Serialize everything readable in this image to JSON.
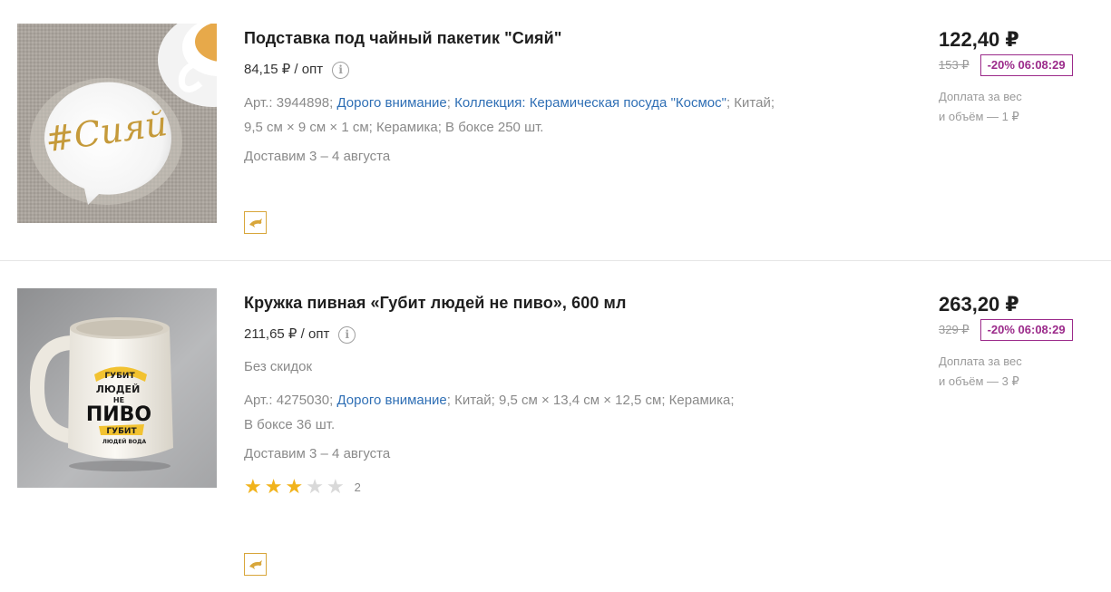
{
  "products": [
    {
      "title": "Подставка под чайный пакетик \"Сияй\"",
      "wholesale_price": "84,15 ₽ / опт",
      "info_icon": "info-circle-icon",
      "details_line1": {
        "sku": "Арт.: 3944898;",
        "tag": "Дорого внимание",
        "sep1": ";",
        "collection": "Коллекция: Керамическая посуда \"Космос\"",
        "sep2": ";",
        "country": "Китай;"
      },
      "details_line2": "9,5 см × 9 см × 1 см;  Керамика;  В боксе 250 шт.",
      "image_text": "#Сияй",
      "delivery": "Доставим 3 – 4 августа",
      "badge_icon": "dolphin-icon",
      "price": "122,40 ₽",
      "old_price": "153 ₽",
      "discount": "-20% 06:08:29",
      "extra_line1": "Доплата за вес",
      "extra_line2": "и объём — 1 ₽"
    },
    {
      "title": "Кружка пивная «Губит людей не пиво», 600 мл",
      "wholesale_price": "211,65 ₽ / опт",
      "info_icon": "info-circle-icon",
      "no_discount": "Без скидок",
      "details_line1": {
        "sku": "Арт.: 4275030;",
        "tag": "Дорого внимание",
        "rest": ";  Китай;  9,5 см × 13,4 см × 12,5 см;  Керамика;"
      },
      "details_line2": "В боксе 36 шт.",
      "image_text": {
        "top": "ГУБИТ",
        "line1": "ЛЮДЕЙ",
        "line2": "НЕ",
        "line3": "ПИВО",
        "line4": "ГУБИТ",
        "line5": "ЛЮДЕЙ ВОДА"
      },
      "delivery": "Доставим 3 – 4 августа",
      "rating": 3,
      "rating_max": 5,
      "rating_count": "2",
      "badge_icon": "dolphin-icon",
      "price": "263,20 ₽",
      "old_price": "329 ₽",
      "discount": "-20% 06:08:29",
      "extra_line1": "Доплата за вес",
      "extra_line2": "и объём — 3 ₽"
    }
  ],
  "colors": {
    "link": "#2f6fb5",
    "discount": "#9b2a8a",
    "star": "#f1b31c",
    "badge_border": "#d8a63a"
  }
}
